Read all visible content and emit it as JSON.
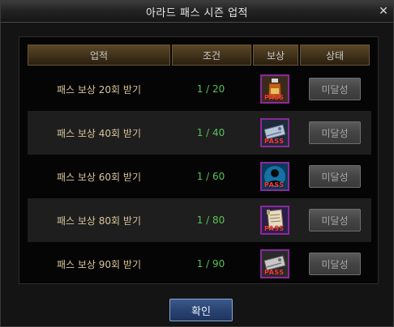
{
  "window": {
    "title": "아라드 패스 시즌 업적",
    "close_glyph": "✕"
  },
  "table": {
    "headers": {
      "name": "업적",
      "condition": "조건",
      "reward": "보상",
      "status": "상태"
    },
    "rows": [
      {
        "name": "패스 보상 20회 받기",
        "condition": "1 / 20",
        "reward_icon": "potion-icon",
        "reward_tag": "PASS",
        "status": "미달성"
      },
      {
        "name": "패스 보상 40회 받기",
        "condition": "1 / 40",
        "reward_icon": "ticket-icon",
        "reward_tag": "PASS",
        "status": "미달성"
      },
      {
        "name": "패스 보상 60회 받기",
        "condition": "1 / 60",
        "reward_icon": "avatar-silhouette-icon",
        "reward_tag": "PASS",
        "status": "미달성"
      },
      {
        "name": "패스 보상 80회 받기",
        "condition": "1 / 80",
        "reward_icon": "scroll-icon",
        "reward_tag": "PASS",
        "status": "미달성"
      },
      {
        "name": "패스 보상 90회 받기",
        "condition": "1 / 90",
        "reward_icon": "ticket-icon",
        "reward_tag": "PASS",
        "status": "미달성"
      }
    ]
  },
  "footer": {
    "confirm_label": "확인"
  },
  "colors": {
    "name_text": "#d8c49a",
    "condition_text": "#58c058",
    "reward_border": "#8a2a9a",
    "pass_tag": "#ff3a3a",
    "confirm_button": "#2a4472"
  }
}
